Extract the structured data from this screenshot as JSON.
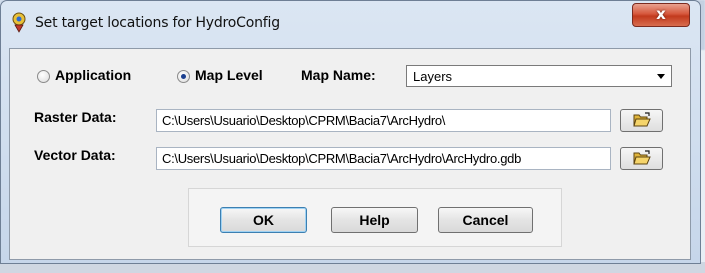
{
  "window": {
    "title": "Set target locations for HydroConfig",
    "close_label": "x"
  },
  "target": {
    "options": [
      {
        "label": "Application",
        "selected": false
      },
      {
        "label": "Map Level",
        "selected": true
      }
    ],
    "map_name_label": "Map Name:",
    "map_name_value": "Layers"
  },
  "raster": {
    "label": "Raster Data:",
    "path": "C:\\Users\\Usuario\\Desktop\\CPRM\\Bacia7\\ArcHydro\\"
  },
  "vector": {
    "label": "Vector Data:",
    "path": "C:\\Users\\Usuario\\Desktop\\CPRM\\Bacia7\\ArcHydro\\ArcHydro.gdb"
  },
  "buttons": {
    "ok": "OK",
    "help": "Help",
    "cancel": "Cancel"
  },
  "icons": {
    "app": "hydro-config-icon",
    "browse": "open-folder-icon"
  }
}
